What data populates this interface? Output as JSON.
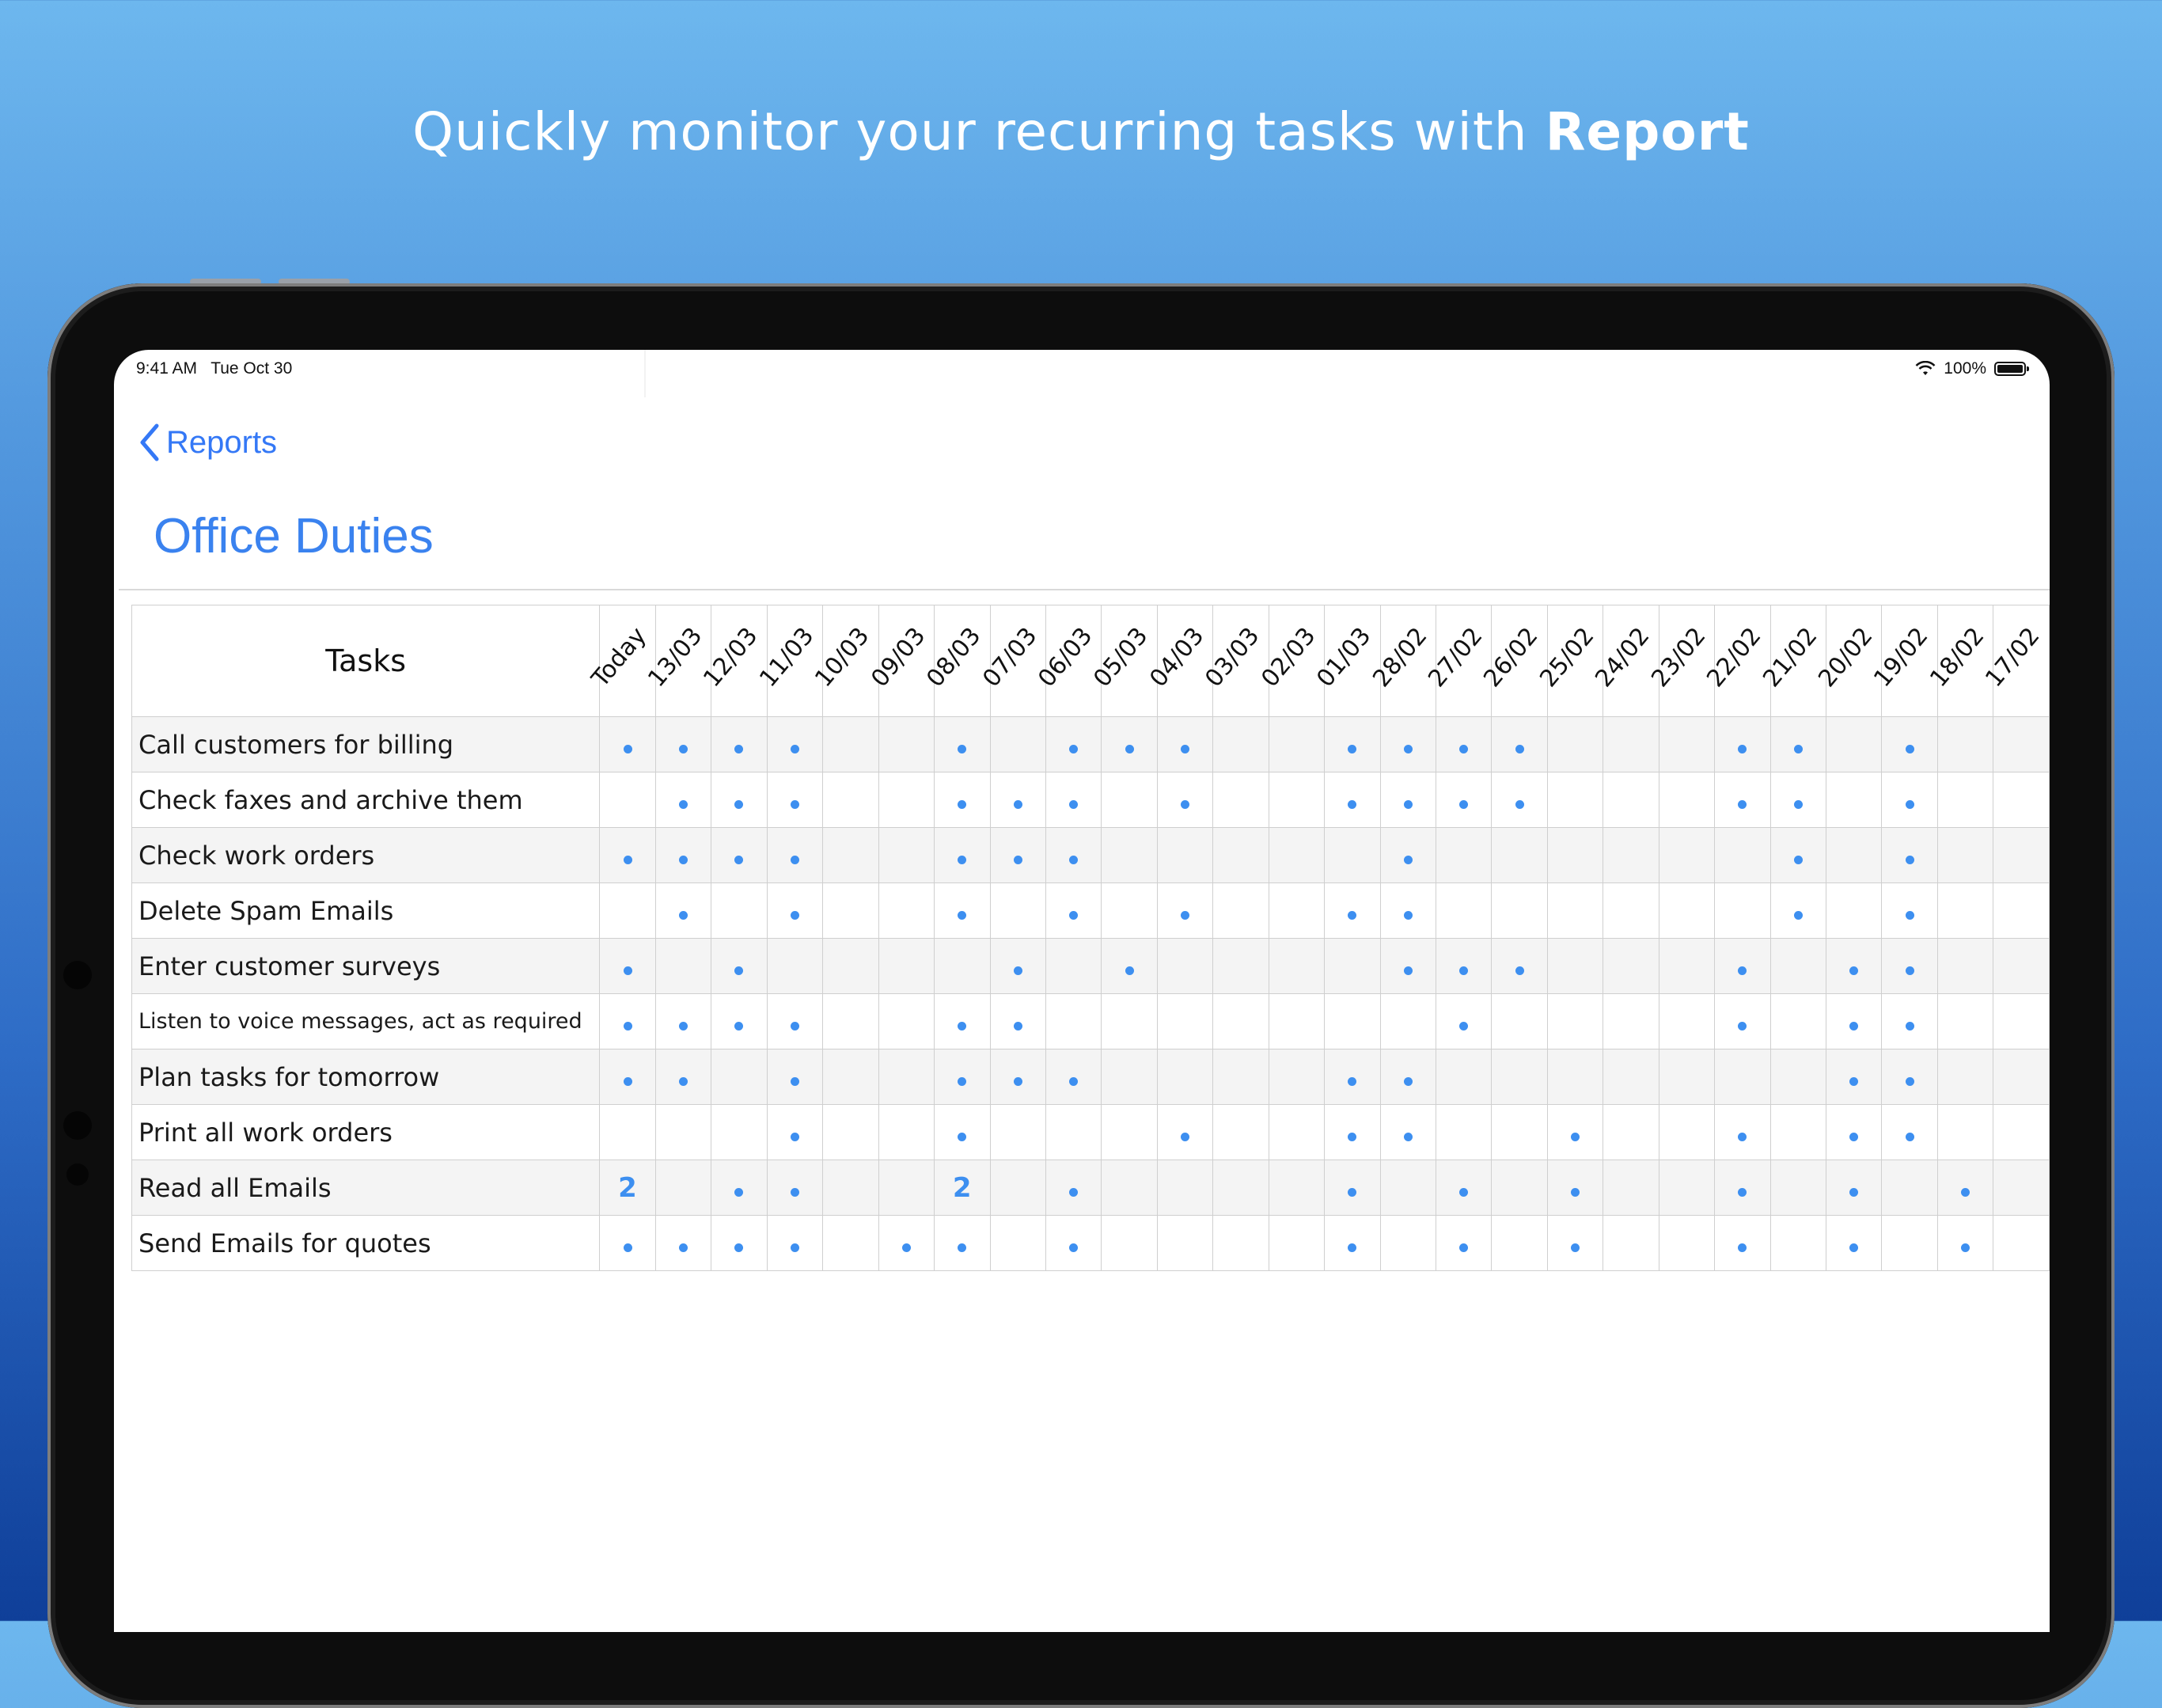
{
  "headline": {
    "prefix": "Quickly monitor your recurring tasks with ",
    "emphasis": "Report"
  },
  "status": {
    "time": "9:41 AM",
    "date": "Tue Oct 30",
    "battery": "100%"
  },
  "nav": {
    "back_label": "Reports"
  },
  "page_title": "Office Duties",
  "table": {
    "task_header": "Tasks",
    "dates": [
      "Today",
      "13/03",
      "12/03",
      "11/03",
      "10/03",
      "09/03",
      "08/03",
      "07/03",
      "06/03",
      "05/03",
      "04/03",
      "03/03",
      "02/03",
      "01/03",
      "28/02",
      "27/02",
      "26/02",
      "25/02",
      "24/02",
      "23/02",
      "22/02",
      "21/02",
      "20/02",
      "19/02",
      "18/02",
      "17/02"
    ],
    "rows": [
      {
        "task": "Call customers for billing",
        "cells": [
          "•",
          "•",
          "•",
          "•",
          "",
          "",
          "•",
          "",
          "•",
          "•",
          "•",
          "",
          "",
          "•",
          "•",
          "•",
          "•",
          "",
          "",
          "",
          "•",
          "•",
          "",
          "•",
          "",
          ""
        ]
      },
      {
        "task": "Check faxes and archive them",
        "cells": [
          "",
          "•",
          "•",
          "•",
          "",
          "",
          "•",
          "•",
          "•",
          "",
          "•",
          "",
          "",
          "•",
          "•",
          "•",
          "•",
          "",
          "",
          "",
          "•",
          "•",
          "",
          "•",
          "",
          ""
        ]
      },
      {
        "task": "Check work orders",
        "cells": [
          "•",
          "•",
          "•",
          "•",
          "",
          "",
          "•",
          "•",
          "•",
          "",
          "",
          "",
          "",
          "",
          "•",
          "",
          "",
          "",
          "",
          "",
          "",
          "•",
          "",
          "•",
          "",
          ""
        ]
      },
      {
        "task": "Delete Spam Emails",
        "cells": [
          "",
          "•",
          "",
          "•",
          "",
          "",
          "•",
          "",
          "•",
          "",
          "•",
          "",
          "",
          "•",
          "•",
          "",
          "",
          "",
          "",
          "",
          "",
          "•",
          "",
          "•",
          "",
          ""
        ]
      },
      {
        "task": "Enter customer   surveys",
        "cells": [
          "•",
          "",
          "•",
          "",
          "",
          "",
          "",
          "•",
          "",
          "•",
          "",
          "",
          "",
          "",
          "•",
          "•",
          "•",
          "",
          "",
          "",
          "•",
          "",
          "•",
          "•",
          "",
          ""
        ]
      },
      {
        "task": "Listen to voice messages, act as required",
        "cells": [
          "•",
          "•",
          "•",
          "•",
          "",
          "",
          "•",
          "•",
          "",
          "",
          "",
          "",
          "",
          "",
          "",
          "•",
          "",
          "",
          "",
          "",
          "•",
          "",
          "•",
          "•",
          "",
          ""
        ]
      },
      {
        "task": "Plan tasks for tomorrow",
        "cells": [
          "•",
          "•",
          "",
          "•",
          "",
          "",
          "•",
          "•",
          "•",
          "",
          "",
          "",
          "",
          "•",
          "•",
          "",
          "",
          "",
          "",
          "",
          "",
          "",
          "•",
          "•",
          "",
          ""
        ]
      },
      {
        "task": "Print all work orders",
        "cells": [
          "",
          "",
          "",
          "•",
          "",
          "",
          "•",
          "",
          "",
          "",
          "•",
          "",
          "",
          "•",
          "•",
          "",
          "",
          "•",
          "",
          "",
          "•",
          "",
          "•",
          "•",
          "",
          ""
        ]
      },
      {
        "task": "Read all Emails",
        "cells": [
          "2",
          "",
          "•",
          "•",
          "",
          "",
          "2",
          "",
          "•",
          "",
          "",
          "",
          "",
          "•",
          "",
          "•",
          "",
          "•",
          "",
          "",
          "•",
          "",
          "•",
          "",
          "•",
          ""
        ]
      },
      {
        "task": "Send Emails for quotes",
        "cells": [
          "•",
          "•",
          "•",
          "•",
          "",
          "•",
          "•",
          "",
          "•",
          "",
          "",
          "",
          "",
          "•",
          "",
          "•",
          "",
          "•",
          "",
          "",
          "•",
          "",
          "•",
          "",
          "•",
          ""
        ]
      }
    ]
  },
  "colors": {
    "accent": "#3478f6",
    "dot": "#3d8ff0"
  }
}
